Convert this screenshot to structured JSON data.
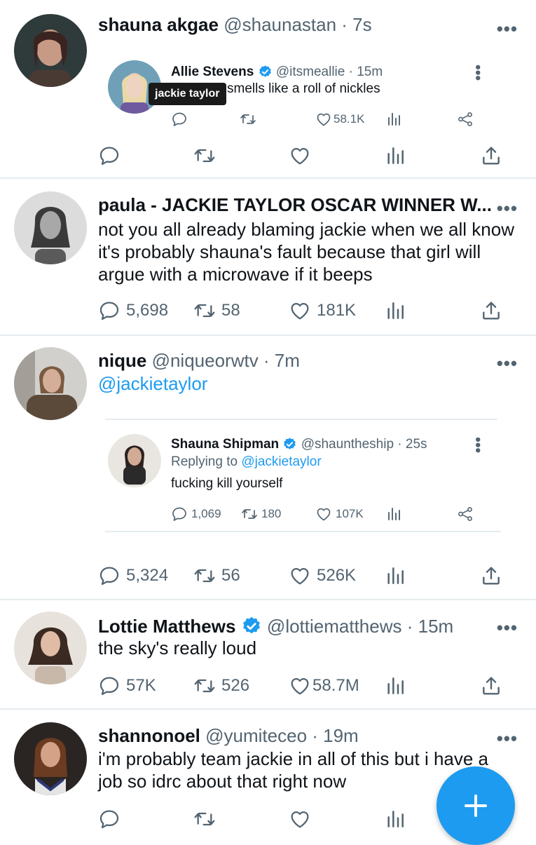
{
  "colors": {
    "accent": "#1d9bf0",
    "text": "#0f1419",
    "muted": "#536471",
    "divider": "#e6ecf0"
  },
  "tweets": [
    {
      "name": "shauna akgae",
      "meta": "@shaunastan · 7s",
      "more": "•••",
      "quote": {
        "name": "Allie Stevens",
        "meta": "@itsmeallie · 15m",
        "text": "smells like a roll of nickles",
        "tooltip": "jackie taylor",
        "likes": "58.1K"
      },
      "actions": {
        "replies": "",
        "retweets": "",
        "likes": ""
      }
    },
    {
      "name": "paula - JACKIE TAYLOR OSCAR WINNER W...",
      "meta": "",
      "more": "•••",
      "text": "not you all already blaming jackie when we all know it's probably shauna's fault because that girl will argue with a microwave if it beeps",
      "actions": {
        "replies": "5,698",
        "retweets": "58",
        "likes": "181K"
      }
    },
    {
      "name": "nique",
      "meta": "@niqueorwtv · 7m",
      "more": "•••",
      "text": "@jackietaylor",
      "quote": {
        "name": "Shauna Shipman",
        "meta": "@shauntheship · 25s",
        "replying_prefix": "Replying to ",
        "replying_to": "@jackietaylor",
        "text": "fucking kill yourself",
        "replies": "1,069",
        "retweets": "180",
        "likes": "107K"
      },
      "actions": {
        "replies": "5,324",
        "retweets": "56",
        "likes": "526K"
      }
    },
    {
      "name": "Lottie Matthews",
      "meta": "@lottiematthews · 15m",
      "more": "•••",
      "text": "the sky's really loud",
      "actions": {
        "replies": "57K",
        "retweets": "526",
        "likes": "58.7M"
      }
    },
    {
      "name": "shannonoel",
      "meta": "@yumiteceo · 19m",
      "more": "•••",
      "text": "i'm probably team jackie in all of this but i have a job so idrc about that right now",
      "actions": {
        "replies": "",
        "retweets": "",
        "likes": ""
      }
    }
  ]
}
